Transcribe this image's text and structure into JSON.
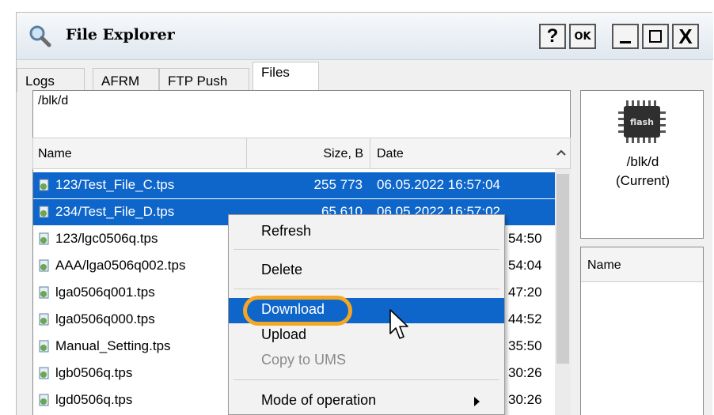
{
  "window": {
    "title": "File Explorer",
    "buttons": {
      "help": "?",
      "ok": "OK",
      "close": "X"
    }
  },
  "tabs": [
    {
      "label": "Logs",
      "active": false
    },
    {
      "label": "AFRM",
      "active": false
    },
    {
      "label": "FTP Push",
      "active": false
    },
    {
      "label": "Files",
      "active": true
    }
  ],
  "path": "/blk/d",
  "columns": {
    "name": "Name",
    "size": "Size, B",
    "date": "Date"
  },
  "files": [
    {
      "name": "123/Test_File_C.tps",
      "size": "255 773",
      "date": "06.05.2022 16:57:04",
      "selected": true
    },
    {
      "name": "234/Test_File_D.tps",
      "size": "65 610",
      "date": "06.05.2022 16:57:02",
      "selected": true
    },
    {
      "name": "123/lgc0506q.tps",
      "time_partial": "54:50"
    },
    {
      "name": "AAA/lga0506q002.tps",
      "time_partial": "54:04"
    },
    {
      "name": "lga0506q001.tps",
      "time_partial": "47:20"
    },
    {
      "name": "lga0506q000.tps",
      "time_partial": "44:52"
    },
    {
      "name": "Manual_Setting.tps",
      "time_partial": "35:50"
    },
    {
      "name": "lgb0506q.tps",
      "time_partial": "30:26"
    },
    {
      "name": "lgd0506q.tps",
      "time_partial": "30:26"
    }
  ],
  "right_panel": {
    "chip_label": "flash",
    "path": "/blk/d",
    "status": "(Current)",
    "column": "Name"
  },
  "context_menu": {
    "items": [
      {
        "label": "Refresh",
        "state": "normal"
      },
      {
        "label": "Delete",
        "state": "normal"
      },
      {
        "label": "Download",
        "state": "highlighted"
      },
      {
        "label": "Upload",
        "state": "normal"
      },
      {
        "label": "Copy to UMS",
        "state": "disabled"
      },
      {
        "label": "Mode of operation",
        "state": "submenu"
      }
    ]
  },
  "colors": {
    "selection": "#0e66cb",
    "callout": "#f5a623",
    "window_bg": "#f0f0f0"
  }
}
